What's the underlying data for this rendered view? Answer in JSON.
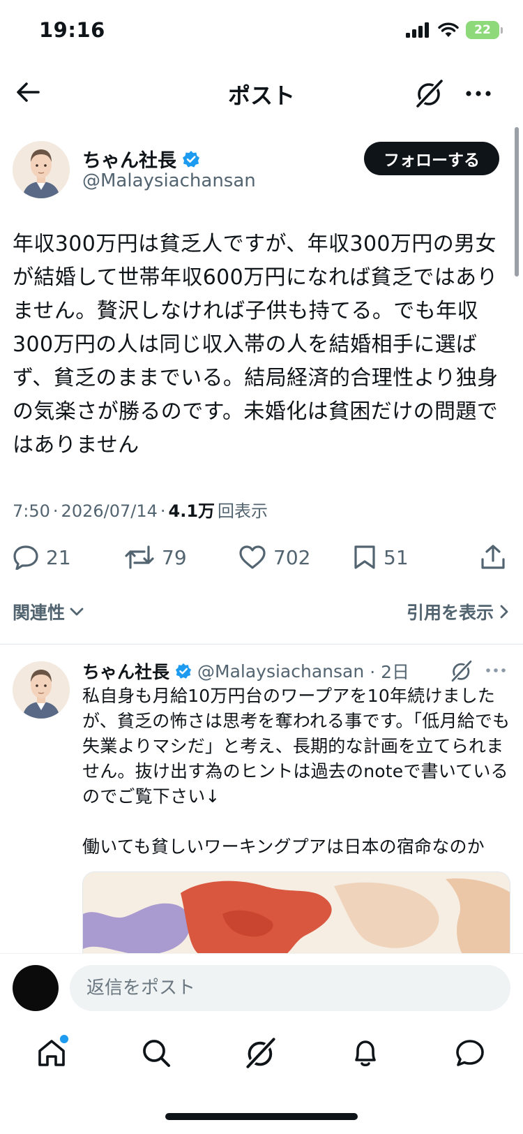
{
  "status_bar": {
    "time": "19:16",
    "battery": "22"
  },
  "header": {
    "title": "ポスト"
  },
  "post": {
    "author_name": "ちゃん社長",
    "author_handle": "@Malaysiachansan",
    "follow_label": "フォローする",
    "text": "年収300万円は貧乏人ですが、年収300万円の男女が結婚して世帯年収600万円になれば貧乏ではありません。贅沢しなければ子供も持てる。でも年収300万円の人は同じ収入帯の人を結婚相手に選ばず、貧乏のままでいる。結局経済的合理性より独身の気楽さが勝るのです。未婚化は貧困だけの問題ではありません",
    "time": "7:50",
    "date": "2026/07/14",
    "views_count": "4.1万",
    "views_label": "回表示",
    "separator": "·",
    "replies": "21",
    "reposts": "79",
    "likes": "702",
    "bookmarks": "51"
  },
  "filters": {
    "sort_label": "関連性",
    "quotes_label": "引用を表示"
  },
  "reply": {
    "author_name": "ちゃん社長",
    "author_handle": "@Malaysiachansan",
    "age": "· 2日",
    "text": "私自身も月給10万円台のワープアを10年続けましたが、貧乏の怖さは思考を奪われる事です。「低月給でも失業よりマシだ」と考え、長期的な計画を立てられません。抜け出す為のヒントは過去のnoteで書いているのでご覧下さい↓\n\n働いても貧しいワーキングプアは日本の宿命なのか"
  },
  "composer": {
    "placeholder": "返信をポスト"
  },
  "colors": {
    "accent": "#1d9bf0",
    "text": "#0f1419",
    "secondary": "#536471",
    "battery": "#8ed97a"
  },
  "icons": {
    "back": "arrow-left-icon",
    "grok": "grok-icon",
    "more": "more-horizontal-icon",
    "verified": "verified-badge-icon",
    "reply": "reply-icon",
    "repost": "repost-icon",
    "like": "heart-icon",
    "bookmark": "bookmark-icon",
    "share": "share-icon",
    "home": "home-icon",
    "search": "search-icon",
    "notifications": "bell-icon",
    "messages": "message-icon"
  }
}
